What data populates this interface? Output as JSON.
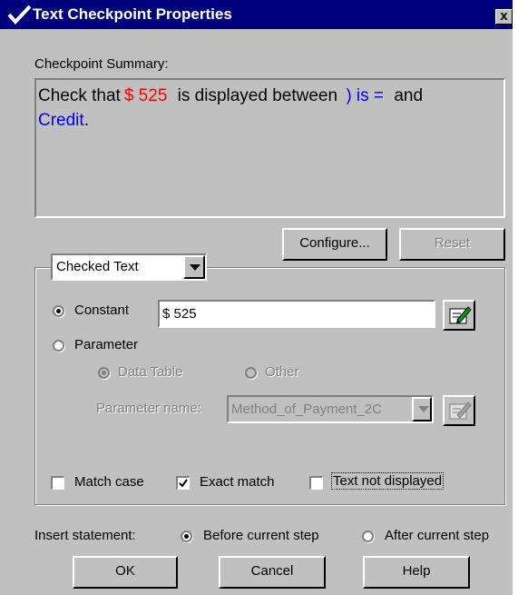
{
  "window": {
    "title": "Text Checkpoint Properties",
    "close_label": "x"
  },
  "summary": {
    "label": "Checkpoint Summary:",
    "text1": "Check that",
    "value": "$ 525",
    "text2": "is  displayed between",
    "after_text": ") is =",
    "text3": "and",
    "before_text": "Credit",
    "end": "."
  },
  "buttons": {
    "configure": "Configure...",
    "reset": "Reset",
    "ok": "OK",
    "cancel": "Cancel",
    "help": "Help"
  },
  "checked_text_dropdown": {
    "selected": "Checked Text"
  },
  "options": {
    "constant_label": "Constant",
    "constant_value": "$ 525",
    "parameter_label": "Parameter",
    "data_table_label": "Data Table",
    "other_label": "Other",
    "parameter_name_label": "Parameter name:",
    "parameter_name_value": "Method_of_Payment_2C"
  },
  "checkboxes": {
    "match_case": "Match case",
    "exact_match": "Exact match",
    "text_not_displayed": "Text not displayed"
  },
  "insert": {
    "label": "Insert statement:",
    "before": "Before current step",
    "after": "After current step"
  },
  "state": {
    "constant_selected": true,
    "parameter_selected": false,
    "data_table_selected": true,
    "match_case_checked": false,
    "exact_match_checked": true,
    "text_not_displayed_checked": false,
    "insert_before_selected": true
  },
  "colors": {
    "title_bar": "#00007f",
    "dialog_face": "#c0c0c0",
    "value_highlight": "#ff0000",
    "boundary_highlight": "#0000ff",
    "disabled_text": "#808080"
  },
  "icons": [
    "checkmark-icon",
    "close-icon",
    "dropdown-arrow-icon",
    "edit-pencil-icon"
  ]
}
